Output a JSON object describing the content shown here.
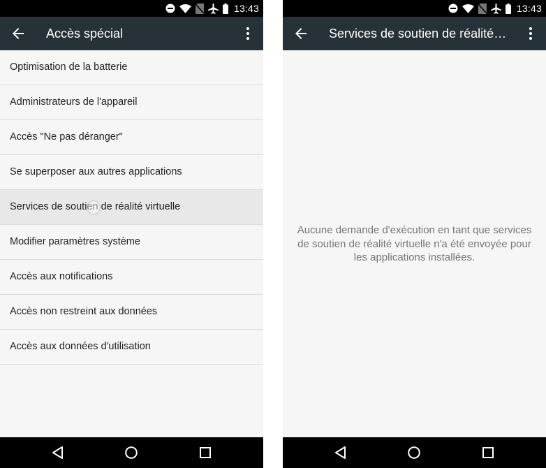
{
  "status_bar": {
    "time": "13:43",
    "icons": [
      "do-not-disturb-icon",
      "wifi-icon",
      "no-sim-icon",
      "airplane-mode-icon",
      "battery-icon"
    ]
  },
  "left_screen": {
    "title": "Accès spécial",
    "items": [
      {
        "label": "Optimisation de la batterie"
      },
      {
        "label": "Administrateurs de l'appareil"
      },
      {
        "label": "Accès \"Ne pas déranger\""
      },
      {
        "label": "Se superposer aux autres applications"
      },
      {
        "label": "Services de soutien de réalité virtuelle"
      },
      {
        "label": "Modifier paramètres système"
      },
      {
        "label": "Accès aux notifications"
      },
      {
        "label": "Accès non restreint aux données"
      },
      {
        "label": "Accès aux données d'utilisation"
      }
    ],
    "pressed_item": "Services de soutien de réalité virtuelle"
  },
  "right_screen": {
    "title": "Services de soutien de réalité…",
    "empty_message_lines": [
      "Aucune demande d'exécution en tant que services",
      "de soutien de réalité virtuelle n'a été envoyée pour",
      "les applications installées."
    ]
  },
  "nav_bar": {
    "buttons": [
      "back-triangle-icon",
      "home-circle-icon",
      "recents-square-icon"
    ]
  },
  "colors": {
    "status_bar": "#000000",
    "app_bar": "#263238",
    "background": "#f6f6f6",
    "divider": "#dcdcdc",
    "pressed": "#e8e8e8",
    "primary_text": "#212121",
    "secondary_text": "#757575"
  }
}
